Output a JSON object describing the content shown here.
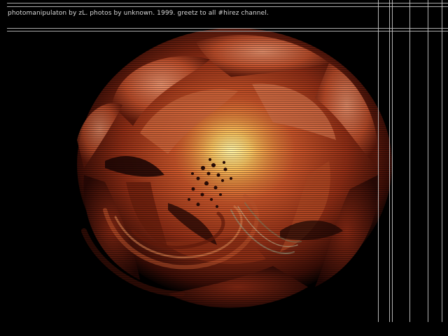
{
  "caption": "photomanipulaton by zL. photos by unknown. 1999. greetz to all #hirez channel.",
  "colors": {
    "background": "#000000",
    "petal_dark": "#3a0d06",
    "petal_mid": "#a33a1c",
    "petal_light": "#e6825a",
    "center_glow": "#ffe890",
    "stamen": "#2a0a05",
    "lines": "#c8c8c8"
  },
  "image_subject": "rose-photomanipulation"
}
